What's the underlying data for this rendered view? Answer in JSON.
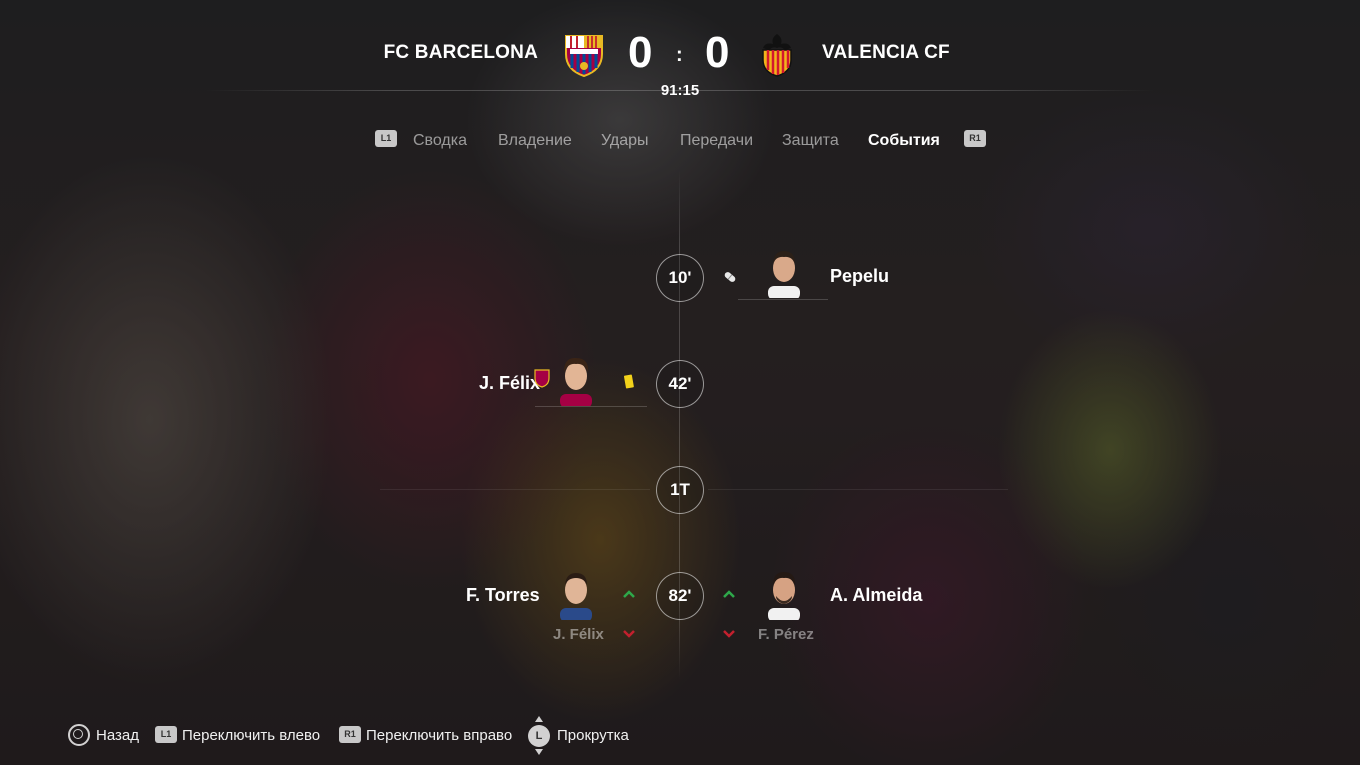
{
  "header": {
    "home_team": "FC BARCELONA",
    "away_team": "VALENCIA CF",
    "home_score": "0",
    "away_score": "0",
    "separator": ":",
    "clock": "91:15"
  },
  "tabs": {
    "left_button": "L1",
    "right_button": "R1",
    "items": [
      "Сводка",
      "Владение",
      "Удары",
      "Передачи",
      "Защита",
      "События"
    ],
    "active": "События"
  },
  "events": [
    {
      "minute": "10'",
      "side": "away",
      "type": "injury",
      "player": "Pepelu"
    },
    {
      "minute": "42'",
      "side": "home",
      "type": "yellow-card",
      "player": "J. Félix"
    },
    {
      "minute": "1Т",
      "type": "half-time"
    },
    {
      "minute": "82'",
      "type": "substitution",
      "home": {
        "in": "F. Torres",
        "out": "J. Félix"
      },
      "away": {
        "in": "A. Almeida",
        "out": "F. Pérez"
      }
    }
  ],
  "colors": {
    "sub_in": "#2ea84a",
    "sub_out": "#c2202e",
    "yellow_card": "#f2d21b"
  },
  "footer": {
    "back": "Назад",
    "l1": "L1",
    "switch_left": "Переключить влево",
    "r1": "R1",
    "switch_right": "Переключить вправо",
    "stick": "L",
    "scroll": "Прокрутка"
  }
}
